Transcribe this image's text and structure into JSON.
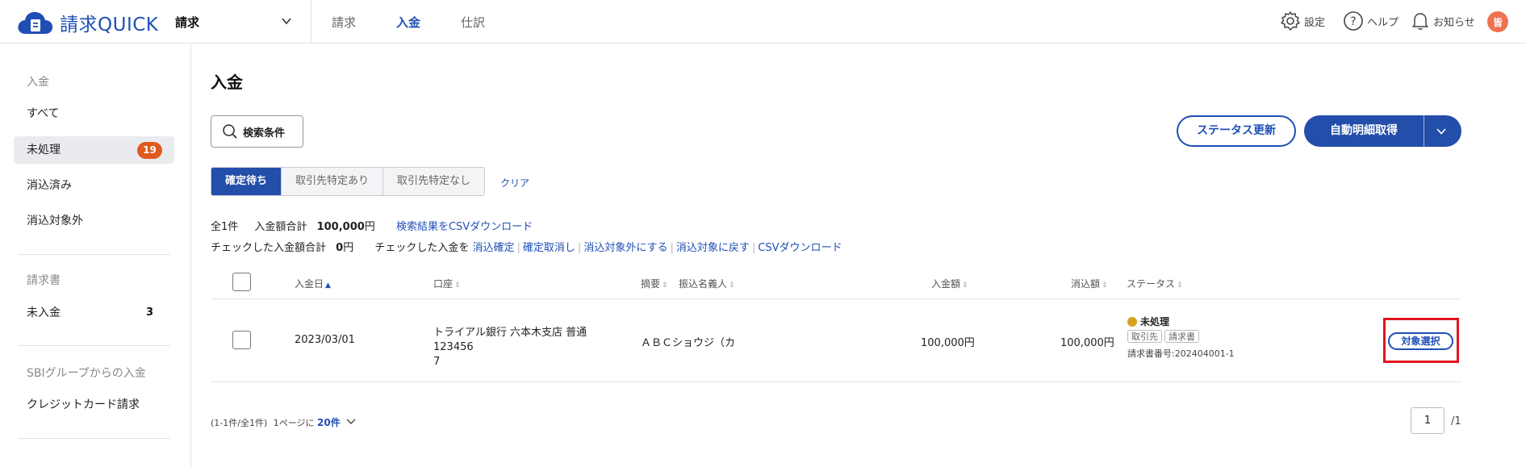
{
  "header": {
    "brand": "請求QUICK",
    "app_selector": "請求",
    "nav": [
      {
        "label": "請求",
        "active": false
      },
      {
        "label": "入金",
        "active": true
      },
      {
        "label": "仕訳",
        "active": false
      }
    ],
    "settings_label": "設定",
    "help_label": "ヘルプ",
    "notice_label": "お知らせ",
    "avatar_initial": "皆"
  },
  "sidebar": {
    "section_payment": "入金",
    "items": [
      {
        "label": "すべて"
      },
      {
        "label": "未処理",
        "badge": "19"
      },
      {
        "label": "消込済み"
      },
      {
        "label": "消込対象外"
      }
    ],
    "section_invoice": "請求書",
    "invoice_items": [
      {
        "label": "未入金",
        "count": "3"
      }
    ],
    "section_sbi": "SBIグループからの入金",
    "sbi_items": [
      {
        "label": "クレジットカード請求"
      }
    ]
  },
  "main": {
    "title": "入金",
    "search_button": "検索条件",
    "status_update_button": "ステータス更新",
    "auto_fetch_button": "自動明細取得",
    "tabs": [
      {
        "label": "確定待ち",
        "active": true
      },
      {
        "label": "取引先特定あり",
        "active": false
      },
      {
        "label": "取引先特定なし",
        "active": false
      }
    ],
    "clear_link": "クリア",
    "summary": {
      "total_count": "全1件",
      "amount_label": "入金額合計",
      "amount_value": "100,000",
      "yen": "円",
      "csv_search_link": "検索結果をCSVダウンロード",
      "checked_amount_label": "チェックした入金額合計",
      "checked_amount_value": "0",
      "checked_action_label": "チェックした入金を",
      "actions": [
        "消込確定",
        "確定取消し",
        "消込対象外にする",
        "消込対象に戻す",
        "CSVダウンロード"
      ]
    },
    "table": {
      "headers": {
        "date": "入金日",
        "account": "口座",
        "memo": "摘要",
        "payer": "振込名義人",
        "amount": "入金額",
        "reconciled": "消込額",
        "status": "ステータス"
      },
      "rows": [
        {
          "date": "2023/03/01",
          "account_line1": "トライアル銀行 六本木支店 普通123456",
          "account_line2": "7",
          "payer": "ＡＢＣショウジ（カ",
          "amount": "100,000円",
          "reconciled": "100,000円",
          "status": "未処理",
          "chip_partner": "取引先",
          "chip_invoice": "請求書",
          "invoice_no": "請求書番号:202404001-1",
          "action": "対象選択"
        }
      ]
    },
    "pager": {
      "range": "(1-1件/全1件)",
      "per_page_label": "1ページに",
      "per_page_value": "20件",
      "current_page": "1",
      "total_pages": "/1"
    }
  },
  "colors": {
    "primary": "#234ea9",
    "badge": "#e05a1e",
    "status_dot": "#d6a21e",
    "highlight": "#e0141e"
  }
}
